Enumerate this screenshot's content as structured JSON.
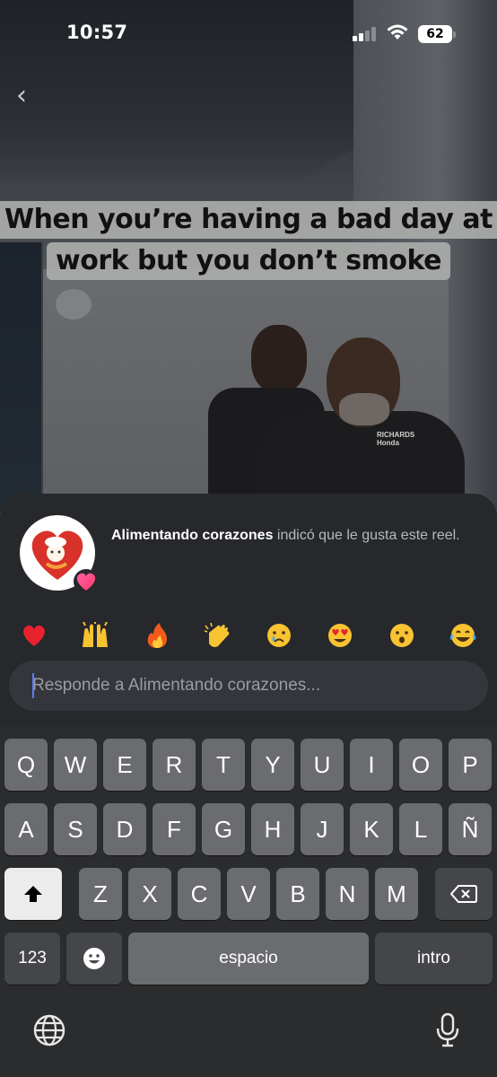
{
  "status_bar": {
    "time": "10:57",
    "battery": "62"
  },
  "video": {
    "caption_line1": "When you’re having a bad day at",
    "caption_line2": "work but you don’t smoke",
    "shirt_logo": "RICHARDS Honda"
  },
  "notification": {
    "name": "Alimentando corazones",
    "message": " indicó que le gusta este reel."
  },
  "reactions": [
    {
      "icon": "red-heart-icon",
      "glyph": "❤️"
    },
    {
      "icon": "raising-hands-icon",
      "glyph": "🙌"
    },
    {
      "icon": "fire-icon",
      "glyph": "🔥"
    },
    {
      "icon": "clapping-hands-icon",
      "glyph": "👏"
    },
    {
      "icon": "crying-face-icon",
      "glyph": "😢"
    },
    {
      "icon": "heart-eyes-icon",
      "glyph": "😍"
    },
    {
      "icon": "surprised-face-icon",
      "glyph": "😮"
    },
    {
      "icon": "tears-of-joy-icon",
      "glyph": "😂"
    }
  ],
  "reply": {
    "placeholder": "Responde a Alimentando corazones..."
  },
  "keyboard": {
    "row1": [
      "Q",
      "W",
      "E",
      "R",
      "T",
      "Y",
      "U",
      "I",
      "O",
      "P"
    ],
    "row2": [
      "A",
      "S",
      "D",
      "F",
      "G",
      "H",
      "J",
      "K",
      "L",
      "Ñ"
    ],
    "row3": [
      "Z",
      "X",
      "C",
      "V",
      "B",
      "N",
      "M"
    ],
    "numbers_label": "123",
    "space_label": "espacio",
    "return_label": "intro"
  },
  "colors": {
    "sheet_bg": "#26282c",
    "key_bg": "#6b6c6f",
    "caption_bg": "#aaacaa",
    "caret": "#5b7cff"
  }
}
